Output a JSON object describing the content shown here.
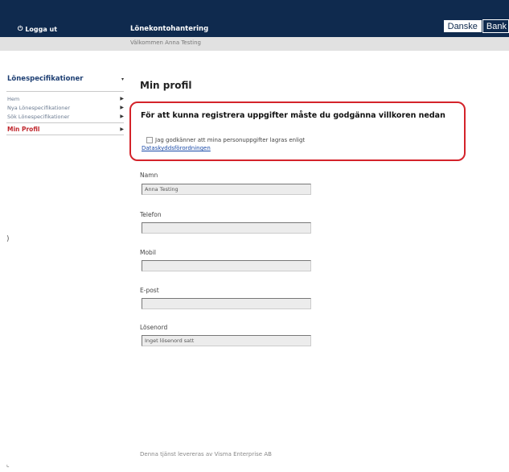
{
  "header": {
    "logout_label": "Logga ut",
    "app_title": "Lönekontohantering",
    "brand_part1": "Danske",
    "brand_part2": "Bank"
  },
  "subheader": {
    "welcome": "Välkommen Anna Testing"
  },
  "sidebar": {
    "heading": "Lönespecifikationer",
    "heading_icon": "▾",
    "items": [
      {
        "label": "Hem"
      },
      {
        "label": "Nya Lönespecifikationer"
      },
      {
        "label": "Sök Lönespecifikationer"
      },
      {
        "label": "Min Profil"
      }
    ]
  },
  "main": {
    "title": "Min profil",
    "notice": "För att kunna registrera uppgifter måste du godgänna villkoren nedan",
    "consent_text": "Jag godkänner att mina personuppgifter lagras enligt",
    "consent_link": "Dataskyddsförordningen",
    "fields": [
      {
        "label": "Namn",
        "value": "Anna  Testing"
      },
      {
        "label": "Telefon",
        "value": ""
      },
      {
        "label": "Mobil",
        "value": ""
      },
      {
        "label": "E-post",
        "value": ""
      },
      {
        "label": "Lösenord",
        "value": "Inget lösenord satt"
      }
    ]
  },
  "footer": {
    "text": "Denna tjänst levereras av Visma Enterprise AB"
  },
  "colors": {
    "header_bg": "#0f2a4e",
    "accent_red": "#d4232a",
    "nav_blue": "#1e3f73"
  }
}
